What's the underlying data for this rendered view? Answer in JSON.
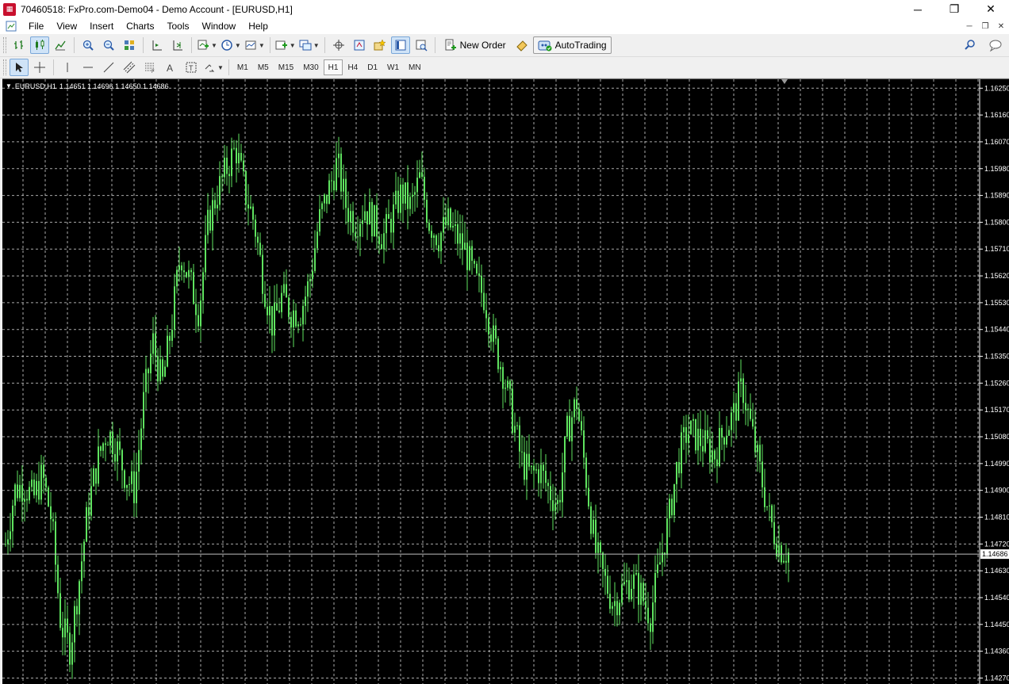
{
  "window": {
    "title": "70460518: FxPro.com-Demo04 - Demo Account - [EURUSD,H1]",
    "controls": [
      "─",
      "❐",
      "✕"
    ]
  },
  "menu": [
    "File",
    "View",
    "Insert",
    "Charts",
    "Tools",
    "Window",
    "Help"
  ],
  "toolbar": {
    "new_order": "New Order",
    "autotrading": "AutoTrading"
  },
  "timeframes": [
    "M1",
    "M5",
    "M15",
    "M30",
    "H1",
    "H4",
    "D1",
    "W1",
    "MN"
  ],
  "active_timeframe": "H1",
  "chart": {
    "symbol": "EURUSD,H1",
    "ohlc": "1.14651 1.14696 1.14650 1.14686",
    "current_price": "1.14686",
    "bull_color": "#5fe35f",
    "bg_color": "#000000",
    "grid_color": "#c8c8c8"
  },
  "chart_data": {
    "type": "candlestick",
    "symbol": "EURUSD",
    "timeframe": "H1",
    "y_ticks": [
      "1.16250",
      "1.16160",
      "1.16070",
      "1.15980",
      "1.15890",
      "1.15800",
      "1.15710",
      "1.15620",
      "1.15530",
      "1.15440",
      "1.15350",
      "1.15260",
      "1.15170",
      "1.15080",
      "1.14990",
      "1.14900",
      "1.14810",
      "1.14720",
      "1.14630",
      "1.14540",
      "1.14450",
      "1.14360",
      "1.14270"
    ],
    "ylim": [
      1.1425,
      1.1628
    ],
    "close_path": [
      1.1472,
      1.149,
      1.1492,
      1.1487,
      1.1495,
      1.148,
      1.1445,
      1.1437,
      1.146,
      1.1485,
      1.15,
      1.151,
      1.1505,
      1.1495,
      1.149,
      1.152,
      1.154,
      1.1525,
      1.1545,
      1.157,
      1.156,
      1.155,
      1.158,
      1.159,
      1.1598,
      1.1605,
      1.159,
      1.158,
      1.156,
      1.1545,
      1.1555,
      1.155,
      1.155,
      1.156,
      1.158,
      1.159,
      1.16,
      1.1585,
      1.158,
      1.1585,
      1.158,
      1.1575,
      1.1582,
      1.159,
      1.1585,
      1.1595,
      1.158,
      1.1575,
      1.158,
      1.1575,
      1.157,
      1.156,
      1.1555,
      1.154,
      1.153,
      1.1515,
      1.15,
      1.1495,
      1.1497,
      1.149,
      1.1485,
      1.151,
      1.152,
      1.1495,
      1.147,
      1.146,
      1.1452,
      1.1457,
      1.146,
      1.1455,
      1.1448,
      1.1465,
      1.148,
      1.15,
      1.151,
      1.1508,
      1.1505,
      1.1502,
      1.151,
      1.1515,
      1.1525,
      1.151,
      1.1495,
      1.148,
      1.1471,
      1.1469
    ]
  }
}
